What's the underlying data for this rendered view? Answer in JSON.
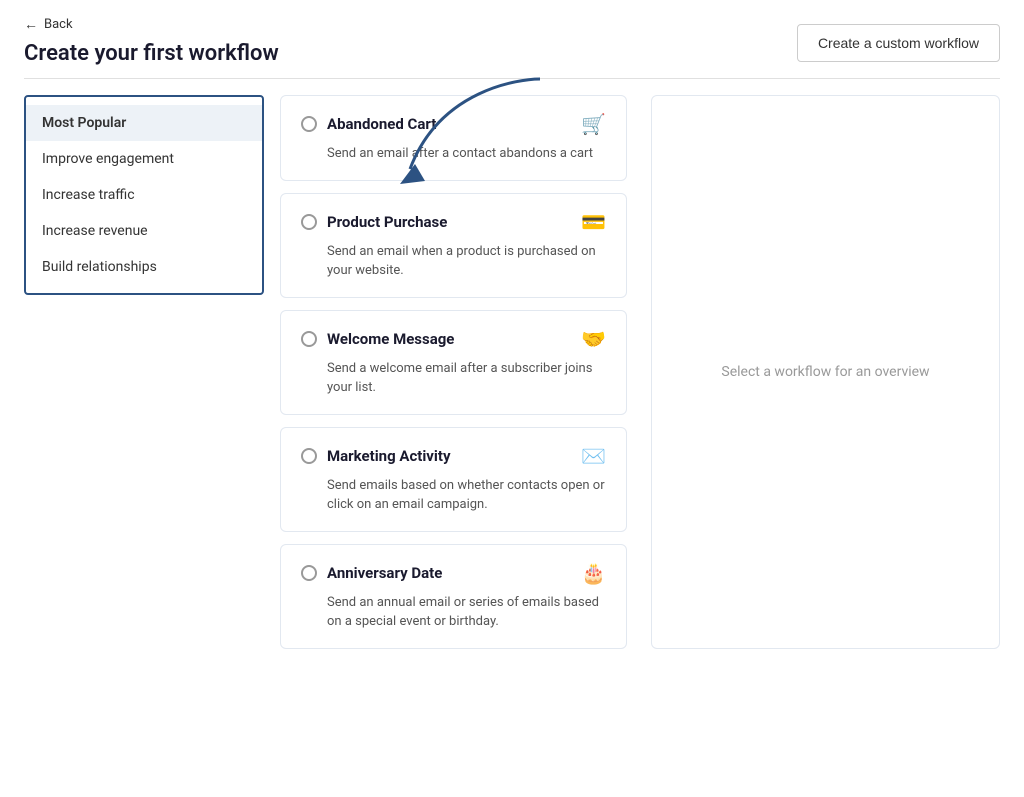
{
  "header": {
    "back_label": "Back",
    "page_title": "Create your first workflow",
    "create_custom_label": "Create a custom workflow"
  },
  "sidebar": {
    "items": [
      {
        "id": "most-popular",
        "label": "Most Popular",
        "active": true
      },
      {
        "id": "improve-engagement",
        "label": "Improve engagement",
        "active": false
      },
      {
        "id": "increase-traffic",
        "label": "Increase traffic",
        "active": false
      },
      {
        "id": "increase-revenue",
        "label": "Increase revenue",
        "active": false
      },
      {
        "id": "build-relationships",
        "label": "Build relationships",
        "active": false
      }
    ]
  },
  "workflows": [
    {
      "id": "abandoned-cart",
      "title": "Abandoned Cart",
      "description": "Send an email after a contact abandons a cart",
      "icon": "🛒"
    },
    {
      "id": "product-purchase",
      "title": "Product Purchase",
      "description": "Send an email when a product is purchased on your website.",
      "icon": "💳"
    },
    {
      "id": "welcome-message",
      "title": "Welcome Message",
      "description": "Send a welcome email after a subscriber joins your list.",
      "icon": "🤝"
    },
    {
      "id": "marketing-activity",
      "title": "Marketing Activity",
      "description": "Send emails based on whether contacts open or click on an email campaign.",
      "icon": "✉️"
    },
    {
      "id": "anniversary-date",
      "title": "Anniversary Date",
      "description": "Send an annual email or series of emails based on a special event or birthday.",
      "icon": "🎂"
    }
  ],
  "overview_panel": {
    "placeholder_text": "Select a workflow for an overview"
  }
}
